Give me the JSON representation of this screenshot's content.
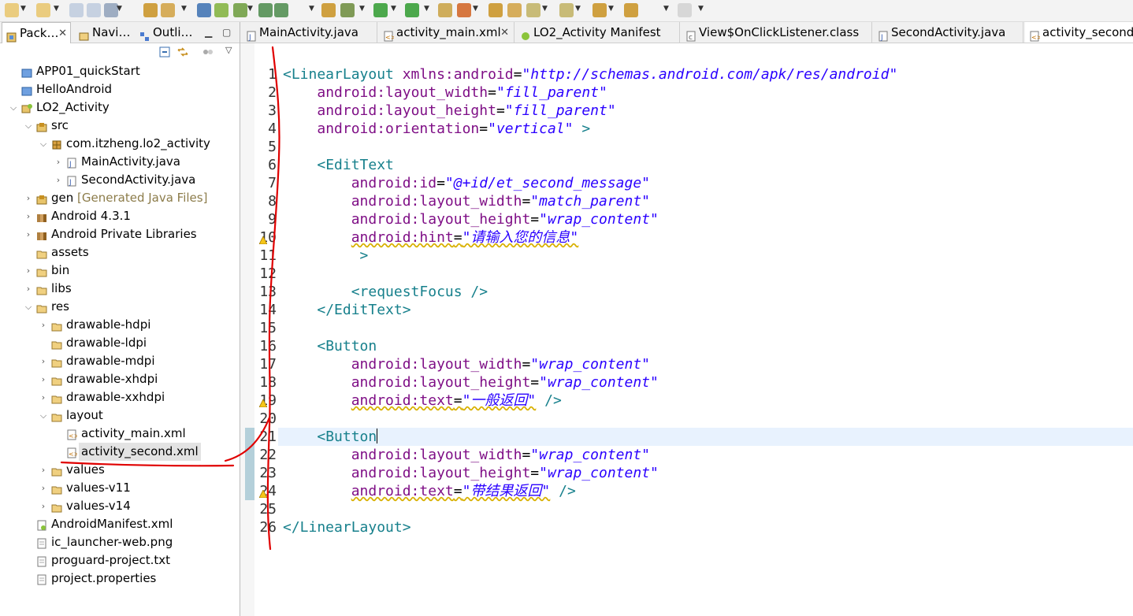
{
  "toolbar": {
    "icons": [
      "new-wizard-icon",
      "new-icon",
      "save-icon",
      "save-all-icon",
      "print-icon",
      "open-type-icon",
      "open-task-icon",
      "pin-icon",
      "android-sdk-icon",
      "avd-manager-icon",
      "lint-icon",
      "run-lint-icon",
      "new-android-project-icon",
      "debug-icon",
      "run-icon",
      "external-tools-icon",
      "open-package-icon",
      "new-class-icon",
      "open-folder-icon",
      "search-icon",
      "next-annotation-icon",
      "prev-annotation-icon",
      "last-edit-icon",
      "back-icon",
      "forward-icon"
    ]
  },
  "left_pane": {
    "tabs": [
      {
        "label": "Pack…",
        "close": "✕"
      },
      {
        "label": "Navi…"
      },
      {
        "label": "Outli…"
      }
    ],
    "tree": [
      {
        "label": "APP01_quickStart",
        "indent": 0,
        "twisty": "",
        "icon": "project-icon"
      },
      {
        "label": "HelloAndroid",
        "indent": 0,
        "twisty": "",
        "icon": "project-icon"
      },
      {
        "label": "LO2_Activity",
        "indent": 0,
        "twisty": "⌵",
        "icon": "android-project-icon"
      },
      {
        "label": "src",
        "indent": 1,
        "twisty": "⌵",
        "icon": "source-folder-icon"
      },
      {
        "label": "com.itzheng.lo2_activity",
        "indent": 2,
        "twisty": "⌵",
        "icon": "package-icon"
      },
      {
        "label": "MainActivity.java",
        "indent": 3,
        "twisty": "›",
        "icon": "java-file-icon"
      },
      {
        "label": "SecondActivity.java",
        "indent": 3,
        "twisty": "›",
        "icon": "java-file-icon"
      },
      {
        "label": "gen",
        "indent": 1,
        "twisty": "›",
        "icon": "source-folder-icon",
        "decor": "[Generated Java Files]"
      },
      {
        "label": "Android 4.3.1",
        "indent": 1,
        "twisty": "›",
        "icon": "library-icon"
      },
      {
        "label": "Android Private Libraries",
        "indent": 1,
        "twisty": "›",
        "icon": "library-icon"
      },
      {
        "label": "assets",
        "indent": 1,
        "twisty": "",
        "icon": "folder-icon"
      },
      {
        "label": "bin",
        "indent": 1,
        "twisty": "›",
        "icon": "folder-icon"
      },
      {
        "label": "libs",
        "indent": 1,
        "twisty": "›",
        "icon": "folder-icon"
      },
      {
        "label": "res",
        "indent": 1,
        "twisty": "⌵",
        "icon": "folder-icon"
      },
      {
        "label": "drawable-hdpi",
        "indent": 2,
        "twisty": "›",
        "icon": "folder-icon"
      },
      {
        "label": "drawable-ldpi",
        "indent": 2,
        "twisty": "",
        "icon": "folder-icon"
      },
      {
        "label": "drawable-mdpi",
        "indent": 2,
        "twisty": "›",
        "icon": "folder-icon"
      },
      {
        "label": "drawable-xhdpi",
        "indent": 2,
        "twisty": "›",
        "icon": "folder-icon"
      },
      {
        "label": "drawable-xxhdpi",
        "indent": 2,
        "twisty": "›",
        "icon": "folder-icon"
      },
      {
        "label": "layout",
        "indent": 2,
        "twisty": "⌵",
        "icon": "folder-icon"
      },
      {
        "label": "activity_main.xml",
        "indent": 3,
        "twisty": "",
        "icon": "xml-file-icon"
      },
      {
        "label": "activity_second.xml",
        "indent": 3,
        "twisty": "",
        "icon": "xml-file-icon",
        "selected": true
      },
      {
        "label": "values",
        "indent": 2,
        "twisty": "›",
        "icon": "folder-icon"
      },
      {
        "label": "values-v11",
        "indent": 2,
        "twisty": "›",
        "icon": "folder-icon"
      },
      {
        "label": "values-v14",
        "indent": 2,
        "twisty": "›",
        "icon": "folder-icon"
      },
      {
        "label": "AndroidManifest.xml",
        "indent": 1,
        "twisty": "",
        "icon": "manifest-file-icon"
      },
      {
        "label": "ic_launcher-web.png",
        "indent": 1,
        "twisty": "",
        "icon": "file-icon"
      },
      {
        "label": "proguard-project.txt",
        "indent": 1,
        "twisty": "",
        "icon": "file-icon"
      },
      {
        "label": "project.properties",
        "indent": 1,
        "twisty": "",
        "icon": "file-icon"
      }
    ]
  },
  "editor": {
    "tabs": [
      {
        "label": "MainActivity.java",
        "icon": "java-file-icon"
      },
      {
        "label": "activity_main.xml",
        "icon": "xml-file-icon",
        "close": "✕"
      },
      {
        "label": "LO2_Activity Manifest",
        "icon": "android-icon"
      },
      {
        "label": "View$OnClickListener.class",
        "icon": "class-file-icon"
      },
      {
        "label": "SecondActivity.java",
        "icon": "java-file-icon"
      },
      {
        "label": "activity_second.",
        "icon": "xml-file-icon",
        "active": true
      }
    ],
    "line_numbers": [
      "1",
      "2",
      "3",
      "4",
      "5",
      "6",
      "7",
      "8",
      "9",
      "10",
      "11",
      "12",
      "13",
      "14",
      "15",
      "16",
      "17",
      "18",
      "19",
      "20",
      "21",
      "22",
      "23",
      "24",
      "25",
      "26"
    ],
    "warning_lines": [
      10,
      19,
      24
    ],
    "current_line": 21,
    "lines": [
      [
        [
          "tag",
          "<LinearLayout "
        ],
        [
          "attr",
          "xmlns:android"
        ],
        [
          "eq",
          "="
        ],
        [
          "val",
          "\"http://schemas.android.com/apk/res/android\""
        ]
      ],
      [
        [
          "sp",
          "    "
        ],
        [
          "attr",
          "android:layout_width"
        ],
        [
          "eq",
          "="
        ],
        [
          "val",
          "\"fill_parent\""
        ]
      ],
      [
        [
          "sp",
          "    "
        ],
        [
          "attr",
          "android:layout_height"
        ],
        [
          "eq",
          "="
        ],
        [
          "val",
          "\"fill_parent\""
        ]
      ],
      [
        [
          "sp",
          "    "
        ],
        [
          "attr",
          "android:orientation"
        ],
        [
          "eq",
          "="
        ],
        [
          "val",
          "\"vertical\""
        ],
        [
          "tag",
          " >"
        ]
      ],
      [],
      [
        [
          "sp",
          "    "
        ],
        [
          "tag",
          "<EditText"
        ]
      ],
      [
        [
          "sp",
          "        "
        ],
        [
          "attr",
          "android:id"
        ],
        [
          "eq",
          "="
        ],
        [
          "val",
          "\"@+id/et_second_message\""
        ]
      ],
      [
        [
          "sp",
          "        "
        ],
        [
          "attr",
          "android:layout_width"
        ],
        [
          "eq",
          "="
        ],
        [
          "val",
          "\"match_parent\""
        ]
      ],
      [
        [
          "sp",
          "        "
        ],
        [
          "attr",
          "android:layout_height"
        ],
        [
          "eq",
          "="
        ],
        [
          "val",
          "\"wrap_content\""
        ]
      ],
      [
        [
          "sp",
          "        "
        ],
        [
          "attrw",
          "android:hint"
        ],
        [
          "eqw",
          "="
        ],
        [
          "valw",
          "\"请输入您的信息\""
        ]
      ],
      [
        [
          "sp",
          "         "
        ],
        [
          "tag",
          ">"
        ]
      ],
      [],
      [
        [
          "sp",
          "        "
        ],
        [
          "tag",
          "<requestFocus />"
        ]
      ],
      [
        [
          "sp",
          "    "
        ],
        [
          "tag",
          "</EditText>"
        ]
      ],
      [],
      [
        [
          "sp",
          "    "
        ],
        [
          "tag",
          "<Button"
        ]
      ],
      [
        [
          "sp",
          "        "
        ],
        [
          "attr",
          "android:layout_width"
        ],
        [
          "eq",
          "="
        ],
        [
          "val",
          "\"wrap_content\""
        ]
      ],
      [
        [
          "sp",
          "        "
        ],
        [
          "attr",
          "android:layout_height"
        ],
        [
          "eq",
          "="
        ],
        [
          "val",
          "\"wrap_content\""
        ]
      ],
      [
        [
          "sp",
          "        "
        ],
        [
          "attrw",
          "android:text"
        ],
        [
          "eqw",
          "="
        ],
        [
          "valw",
          "\"一般返回\""
        ],
        [
          "tag",
          " />"
        ]
      ],
      [],
      [
        [
          "sp",
          "    "
        ],
        [
          "tag",
          "<Button"
        ],
        [
          "caret",
          ""
        ]
      ],
      [
        [
          "sp",
          "        "
        ],
        [
          "attr",
          "android:layout_width"
        ],
        [
          "eq",
          "="
        ],
        [
          "val",
          "\"wrap_content\""
        ]
      ],
      [
        [
          "sp",
          "        "
        ],
        [
          "attr",
          "android:layout_height"
        ],
        [
          "eq",
          "="
        ],
        [
          "val",
          "\"wrap_content\""
        ]
      ],
      [
        [
          "sp",
          "        "
        ],
        [
          "attrw",
          "android:text"
        ],
        [
          "eqw",
          "="
        ],
        [
          "valw",
          "\"带结果返回\""
        ],
        [
          "tag",
          " />"
        ]
      ],
      [],
      [
        [
          "tag",
          "</LinearLayout>"
        ]
      ]
    ]
  },
  "colors": {
    "tag": "#17808c",
    "attr": "#7f0f86",
    "value": "#2a00ff",
    "annotation": "#e00000"
  }
}
